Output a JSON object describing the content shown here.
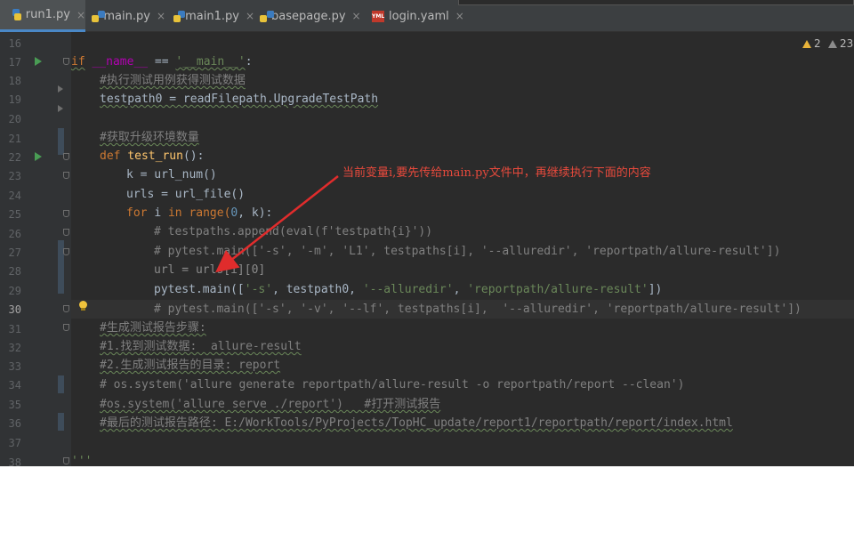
{
  "tabs": [
    {
      "label": "run1.py",
      "icon": "python-file-icon",
      "active": true
    },
    {
      "label": "main.py",
      "icon": "python-file-icon",
      "active": false
    },
    {
      "label": "main1.py",
      "icon": "python-file-icon",
      "active": false
    },
    {
      "label": "basepage.py",
      "icon": "python-file-icon",
      "active": false
    },
    {
      "label": "login.yaml",
      "icon": "yaml-file-icon",
      "active": false
    }
  ],
  "tab_close_glyph": "×",
  "inspections": {
    "warnings": "2",
    "weak_warnings": "23"
  },
  "line_numbers": [
    "16",
    "17",
    "18",
    "19",
    "20",
    "21",
    "22",
    "23",
    "24",
    "25",
    "26",
    "27",
    "28",
    "29",
    "30",
    "31",
    "32",
    "33",
    "34",
    "35",
    "36",
    "37",
    "38"
  ],
  "current_line": "30",
  "annotation": "当前变量i,要先传给main.py文件中，再继续执行下面的内容",
  "code": {
    "l17": {
      "if": "if",
      "name": "__name__",
      "eq": " == ",
      "main": "'__main__'",
      "colon": ":"
    },
    "l18": "#执行测试用例获得测试数据",
    "l19": "testpath0 = readFilepath.UpgradeTestPath",
    "l21": "#获取升级环境数量",
    "l22": {
      "def": "def ",
      "name": "test_run",
      "rest": "():"
    },
    "l23": "k = url_num()",
    "l24": "urls = url_file()",
    "l25": {
      "for": "for ",
      "i": "i ",
      "in": "in ",
      "range": "range(",
      "zero": "0",
      "rest": ", k):"
    },
    "l26": "# testpaths.append(eval(f'testpath{i}'))",
    "l27": "# pytest.main(['-s', '-m', 'L1', testpaths[i], '--alluredir', 'reportpath/allure-result'])",
    "l28": "url = urls[i][0]",
    "l29": {
      "pre": "pytest.main([",
      "s1": "'-s'",
      "mid": ", testpath0, ",
      "s2": "'--alluredir'",
      "comma": ", ",
      "s3": "'reportpath/allure-result'",
      "end": "])"
    },
    "l30": "# pytest.main(['-s', '-v', '--lf', testpaths[i],  '--alluredir', 'reportpath/allure-result'])",
    "l31": "#生成测试报告步骤:",
    "l32": "#1.找到测试数据:  allure-result",
    "l33": "#2.生成测试报告的目录: report",
    "l34": "# os.system('allure generate reportpath/allure-result -o reportpath/report --clean')",
    "l35": "#os.system('allure serve ./report')   #打开测试报告",
    "l36": "#最后的测试报告路径: E:/WorkTools/PyProjects/TopHC_update/report1/reportpath/report/index.html",
    "l38": "'''"
  },
  "colors": {
    "editor_bg": "#2b2b2b",
    "keyword": "#cc7832",
    "string": "#6a8759",
    "comment": "#808080",
    "annotation": "#e84a3c"
  }
}
